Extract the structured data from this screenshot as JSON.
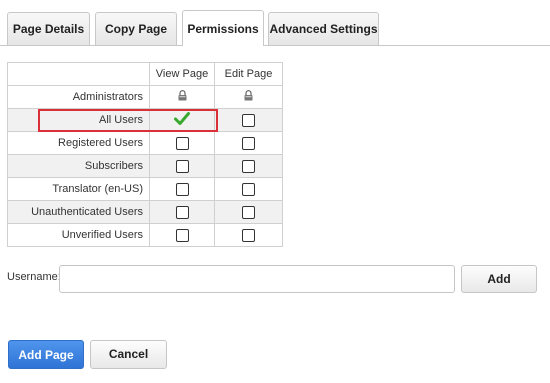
{
  "tabs": [
    {
      "label": "Page Details",
      "active": false
    },
    {
      "label": "Copy Page",
      "active": false
    },
    {
      "label": "Permissions",
      "active": true
    },
    {
      "label": "Advanced Settings",
      "active": false
    }
  ],
  "permissions": {
    "headers": {
      "role": "",
      "view": "View Page",
      "edit": "Edit Page"
    },
    "rows": [
      {
        "role": "Administrators",
        "view": "locked",
        "edit": "locked"
      },
      {
        "role": "All Users",
        "view": "checked",
        "edit": "unchecked"
      },
      {
        "role": "Registered Users",
        "view": "unchecked",
        "edit": "unchecked"
      },
      {
        "role": "Subscribers",
        "view": "unchecked",
        "edit": "unchecked"
      },
      {
        "role": "Translator (en-US)",
        "view": "unchecked",
        "edit": "unchecked"
      },
      {
        "role": "Unauthenticated Users",
        "view": "unchecked",
        "edit": "unchecked"
      },
      {
        "role": "Unverified Users",
        "view": "unchecked",
        "edit": "unchecked"
      }
    ]
  },
  "username": {
    "label": "Username:",
    "value": "",
    "add_label": "Add"
  },
  "actions": {
    "add_page_label": "Add Page",
    "cancel_label": "Cancel"
  },
  "colors": {
    "primary": "#2f73d6",
    "highlight": "#d9303a",
    "check": "#3aa82e"
  }
}
